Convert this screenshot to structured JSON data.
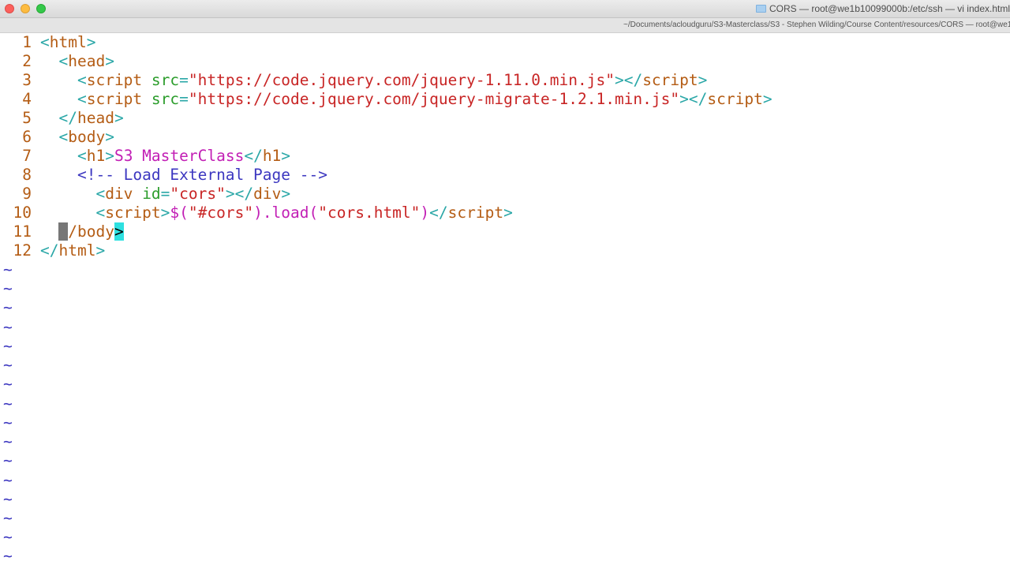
{
  "window": {
    "title": "CORS — root@we1b10099000b:/etc/ssh — vi index.html",
    "path": "~/Documents/acloudguru/S3-Masterclass/S3 - Stephen Wilding/Course Content/resources/CORS — root@we1b"
  },
  "editor": {
    "line_numbers": [
      "1",
      "2",
      "3",
      "4",
      "5",
      "6",
      "7",
      "8",
      "9",
      "10",
      "11",
      "12"
    ],
    "tokens": {
      "lt": "<",
      "gt": ">",
      "lt_slash": "</",
      "eq": "=",
      "html": "html",
      "head": "head",
      "body": "body",
      "script": "script",
      "src": "src",
      "src_jquery": "\"https://code.jquery.com/jquery-1.11.0.min.js\"",
      "src_migrate": "\"https://code.jquery.com/jquery-migrate-1.2.1.min.js\"",
      "h1": "h1",
      "h1_text": "S3 MasterClass",
      "comment": "<!-- Load External Page -->",
      "div": "div",
      "id": "id",
      "id_value": "\"cors\"",
      "js_dollar": "$(",
      "js_selector": "\"#cors\"",
      "js_load": ").load(",
      "js_file": "\"cors.html\"",
      "js_close": ")",
      "cursor_char": "<",
      "body_close_rest": "/body",
      "match_char": ">"
    },
    "empty_marker": "~"
  },
  "colors": {
    "line_number": "#b45c14",
    "tag": "#b45c14",
    "punctuation": "#2aa7a7",
    "attribute": "#2c9d2c",
    "string": "#c82525",
    "comment": "#3c37c0",
    "h1_text": "#c21fb5",
    "tilde": "#3c37c0",
    "bracket_match": "#2ee0e0"
  }
}
